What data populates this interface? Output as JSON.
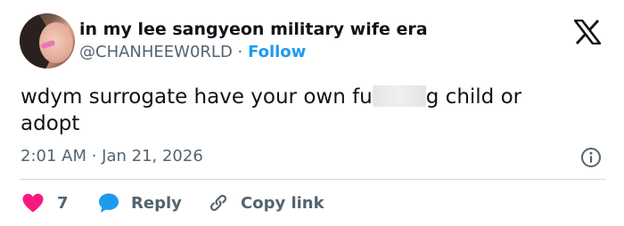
{
  "user": {
    "display_name": "in my lee sangyeon military wife era",
    "handle": "@CHANHEEW0RLD",
    "separator": "·",
    "follow_label": "Follow"
  },
  "tweet": {
    "text_before_censor": "wdym surrogate have your own fu",
    "text_after_censor": "g child or",
    "text_line2": "adopt",
    "timestamp": "2:01 AM · Jan 21, 2026"
  },
  "actions": {
    "like_count": "7",
    "reply_label": "Reply",
    "copy_link_label": "Copy link"
  },
  "icons": {
    "brand": "x-logo-icon",
    "info": "info-icon",
    "like": "heart-icon",
    "reply": "speech-bubble-icon",
    "copy": "link-icon"
  },
  "colors": {
    "text": "#0f1419",
    "secondary": "#536471",
    "accent": "#1d9bf0",
    "like": "#f91880",
    "divider": "#cfd9de"
  }
}
